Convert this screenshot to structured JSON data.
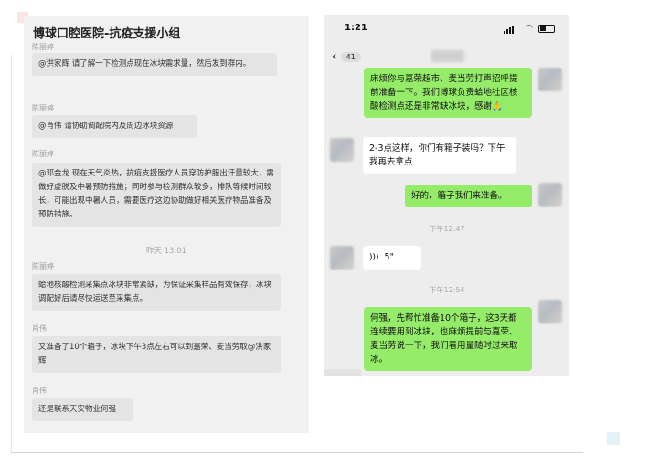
{
  "left": {
    "title": "博球口腔医院-抗疫支援小组",
    "messages": [
      {
        "sender": "陈丽婷",
        "text": "@洪家辉 请了解一下检测点现在冰块需求量，然后发到群内。"
      },
      {
        "sender": "陈丽婷",
        "text": "@肖伟 请协助调配院内及周边冰块资源"
      },
      {
        "sender": "陈丽婷",
        "text": "@邓金龙 现在天气炎热，抗疫支援医疗人员穿防护服出汗量较大，需做好虚脱及中暑预防措施；同时参与检测群众较多，排队等候时间较长，可能出现中暑人员，需要医疗这边协助做好相关医疗物品准备及预防措施。"
      },
      {
        "sender": "陈丽婷",
        "text": "蛤地核酸检测采集点冰块非常紧缺，为保证采集样品有效保存，冰块调配好后请尽快运送至采集点。"
      },
      {
        "sender": "肖伟",
        "text": "又准备了10个箱子，冰块下午3点左右可以到嘉荣、麦当劳取@洪家辉"
      },
      {
        "sender": "肖伟",
        "text": "还是联系天安物业何强"
      }
    ],
    "timestamp": "昨天 13:01"
  },
  "phone": {
    "status_time": "1:21",
    "unread_count": "41",
    "messages": [
      {
        "side": "right",
        "text": "床烦你与嘉荣超市、麦当劳打声招呼提前准备一下。我们博球负责蛤地社区核酸检测点还是非常缺冰块，感谢🙏"
      },
      {
        "side": "left",
        "text": "2-3点这样，你们有箱子装吗？下午我再去拿点"
      },
      {
        "side": "right",
        "text": "好的，箱子我们来准备。"
      },
      {
        "side": "left",
        "text": "5\""
      },
      {
        "side": "right",
        "text": "何强，先帮忙准备10个箱子，这3天都连续要用到冰块，也麻烦提前与嘉荣、麦当劳说一下，我们看用量随时过来取冰。"
      }
    ],
    "times": [
      "下午12:47",
      "下午12:54"
    ]
  }
}
